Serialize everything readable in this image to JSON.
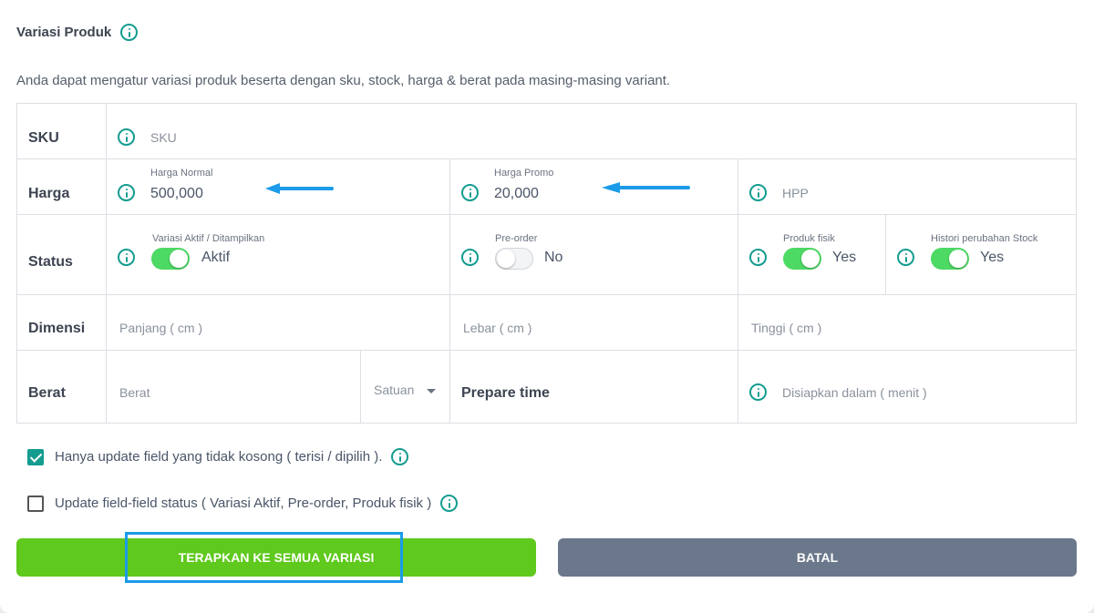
{
  "header": {
    "title": "Variasi Produk",
    "description": "Anda dapat mengatur variasi produk beserta dengan sku, stock, harga & berat pada masing-masing variant."
  },
  "rows": {
    "sku": {
      "label": "SKU",
      "placeholder": "SKU"
    },
    "harga": {
      "label": "Harga",
      "normal": {
        "caption": "Harga Normal",
        "value": "500,000"
      },
      "promo": {
        "caption": "Harga Promo",
        "value": "20,000"
      },
      "hpp": {
        "placeholder": "HPP"
      }
    },
    "status": {
      "label": "Status",
      "aktif": {
        "caption": "Variasi Aktif / Ditampilkan",
        "value": "Aktif",
        "on": true
      },
      "preorder": {
        "caption": "Pre-order",
        "value": "No",
        "on": false
      },
      "fisik": {
        "caption": "Produk fisik",
        "value": "Yes",
        "on": true
      },
      "histori": {
        "caption": "Histori perubahan Stock",
        "value": "Yes",
        "on": true
      }
    },
    "dimensi": {
      "label": "Dimensi",
      "panjang": "Panjang ( cm )",
      "lebar": "Lebar ( cm )",
      "tinggi": "Tinggi ( cm )"
    },
    "berat": {
      "label": "Berat",
      "placeholder": "Berat",
      "satuan": "Satuan",
      "prepare_label": "Prepare time",
      "prepare_placeholder": "Disiapkan dalam ( menit )"
    }
  },
  "options": {
    "update_nonempty": {
      "label": "Hanya update field yang tidak kosong ( terisi / dipilih ).",
      "checked": true
    },
    "update_status": {
      "label": "Update field-field status ( Variasi Aktif, Pre-order, Produk fisik )",
      "checked": false
    }
  },
  "actions": {
    "apply_label": "TERAPKAN KE SEMUA VARIASI",
    "cancel_label": "BATAL"
  },
  "colors": {
    "accent": "#139c8f",
    "toggle_on": "#4cd964",
    "apply": "#5fc91d",
    "cancel": "#6b778a",
    "highlight": "#1b9be8"
  }
}
